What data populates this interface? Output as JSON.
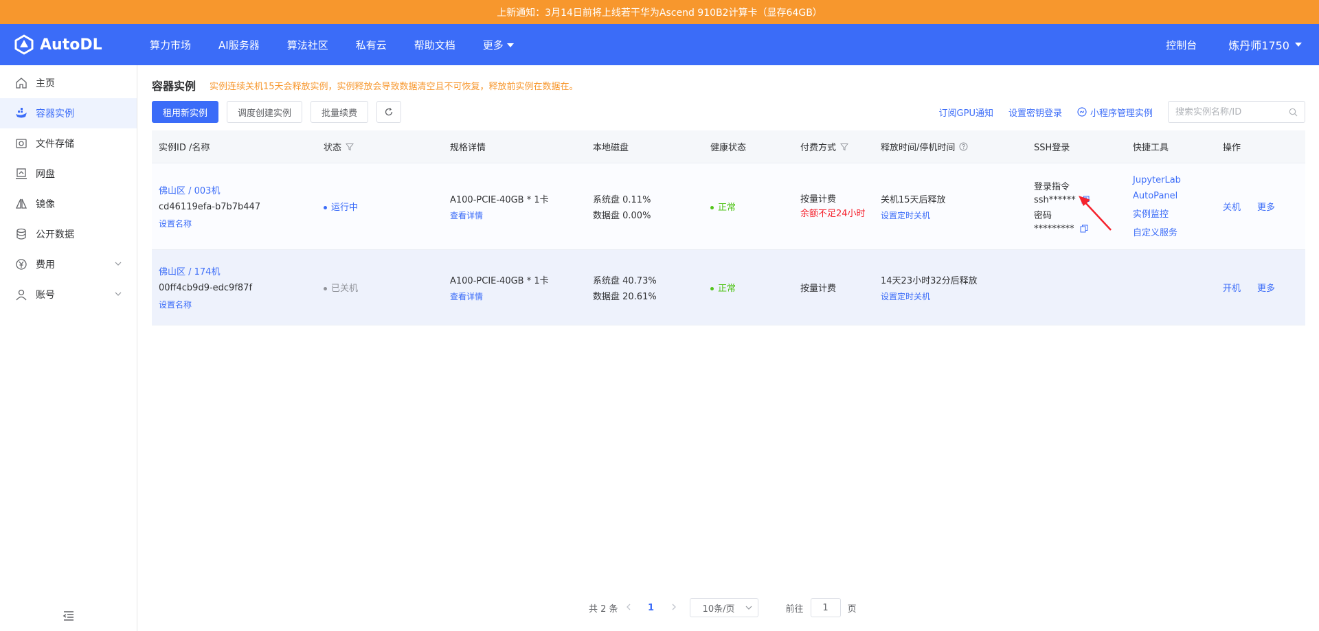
{
  "notice": {
    "text": "上新通知：3月14日前将上线若干华为Ascend 910B2计算卡（显存64GB）"
  },
  "nav": {
    "logo_text": "AutoDL",
    "items": [
      {
        "label": "算力市场"
      },
      {
        "label": "AI服务器"
      },
      {
        "label": "算法社区"
      },
      {
        "label": "私有云"
      },
      {
        "label": "帮助文档"
      },
      {
        "label": "更多"
      }
    ],
    "console": "控制台",
    "user": "炼丹师1750"
  },
  "sidebar": {
    "items": [
      {
        "label": "主页",
        "icon": "home-icon"
      },
      {
        "label": "容器实例",
        "icon": "container-icon",
        "active": true
      },
      {
        "label": "文件存储",
        "icon": "storage-icon"
      },
      {
        "label": "网盘",
        "icon": "netdisk-icon"
      },
      {
        "label": "镜像",
        "icon": "image-icon"
      },
      {
        "label": "公开数据",
        "icon": "database-icon"
      },
      {
        "label": "费用",
        "icon": "yen-icon"
      },
      {
        "label": "账号",
        "icon": "user-icon"
      }
    ]
  },
  "page": {
    "title": "容器实例",
    "warning": "实例连续关机15天会释放实例，实例释放会导致数据清空且不可恢复，释放前实例在数据在。"
  },
  "toolbar": {
    "rent": "租用新实例",
    "schedule": "调度创建实例",
    "renew": "批量续费",
    "subscribe": "订阅GPU通知",
    "ssh_key": "设置密钥登录",
    "miniapp": "小程序管理实例",
    "search_placeholder": "搜索实例名称/ID"
  },
  "table": {
    "headers": [
      "实例ID /名称",
      "状态",
      "规格详情",
      "本地磁盘",
      "健康状态",
      "付费方式",
      "释放时间/停机时间",
      "SSH登录",
      "快捷工具",
      "操作"
    ],
    "rows": [
      {
        "region": "佛山区 / 003机",
        "id": "cd46119efa-b7b7b447",
        "set_name": "设置名称",
        "status": "运行中",
        "spec": "A100-PCIE-40GB * 1卡",
        "spec_link": "查看详情",
        "sys_disk": "系统盘 0.11%",
        "data_disk": "数据盘 0.00%",
        "health": "正常",
        "pay": "按量计费",
        "pay_warn": "余额不足24小时",
        "release": "关机15天后释放",
        "release_link": "设置定时关机",
        "ssh_cmd_label": "登录指令",
        "ssh_cmd": "ssh******",
        "ssh_pwd_label": "密码",
        "ssh_pwd": "*********",
        "tools": [
          "JupyterLab",
          "AutoPanel",
          "实例监控",
          "自定义服务"
        ],
        "op1": "关机",
        "op2": "更多"
      },
      {
        "region": "佛山区 / 174机",
        "id": "00ff4cb9d9-edc9f87f",
        "set_name": "设置名称",
        "status": "已关机",
        "spec": "A100-PCIE-40GB * 1卡",
        "spec_link": "查看详情",
        "sys_disk": "系统盘 40.73%",
        "data_disk": "数据盘 20.61%",
        "health": "正常",
        "pay": "按量计费",
        "release": "14天23小时32分后释放",
        "release_link": "设置定时关机",
        "op1": "开机",
        "op2": "更多"
      }
    ]
  },
  "pager": {
    "total": "共 2 条",
    "current": "1",
    "size": "10条/页",
    "goto": "前往",
    "goto_value": "1",
    "page_unit": "页"
  },
  "colors": {
    "brand": "#3b6cf8",
    "notice": "#f7972d",
    "ok": "#52c41a",
    "danger": "#f5222d"
  }
}
